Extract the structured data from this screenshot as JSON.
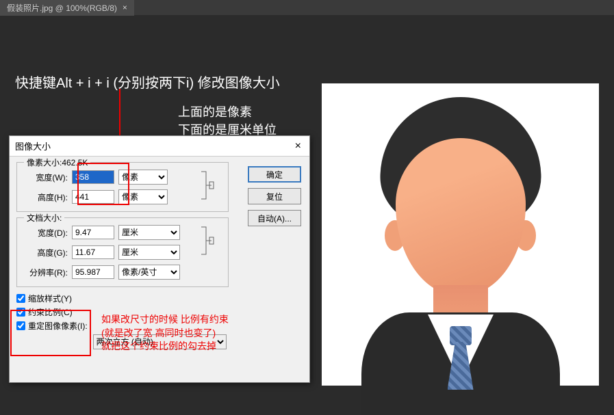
{
  "tab": {
    "label": "假装照片.jpg @ 100%(RGB/8)",
    "close": "×"
  },
  "annotations": {
    "title": "快捷键Alt + i + i (分别按两下i) 修改图像大小",
    "top1": "上面的是像素",
    "top2": "下面的是厘米单位",
    "red1": "如果改尺寸的时候 比例有约束",
    "red2": "(就是改了宽 高同时也变了)",
    "red3": "就把这个约束比例的勾去掉"
  },
  "dialog": {
    "title": "图像大小",
    "close": "×",
    "pixel_group": "像素大小:462.5K",
    "width_label": "宽度(W):",
    "width_val": "358",
    "width_unit": "像素",
    "height_label": "高度(H):",
    "height_val": "441",
    "height_unit": "像素",
    "doc_group": "文档大小:",
    "dwidth_label": "宽度(D):",
    "dwidth_val": "9.47",
    "dwidth_unit": "厘米",
    "dheight_label": "高度(G):",
    "dheight_val": "11.67",
    "dheight_unit": "厘米",
    "res_label": "分辨率(R):",
    "res_val": "95.987",
    "res_unit": "像素/英寸",
    "cb1": "缩放样式(Y)",
    "cb2": "约束比例(C)",
    "cb3": "重定图像像素(I):",
    "resample": "两次立方 (自动)",
    "btn_ok": "确定",
    "btn_reset": "复位",
    "btn_auto": "自动(A)..."
  }
}
